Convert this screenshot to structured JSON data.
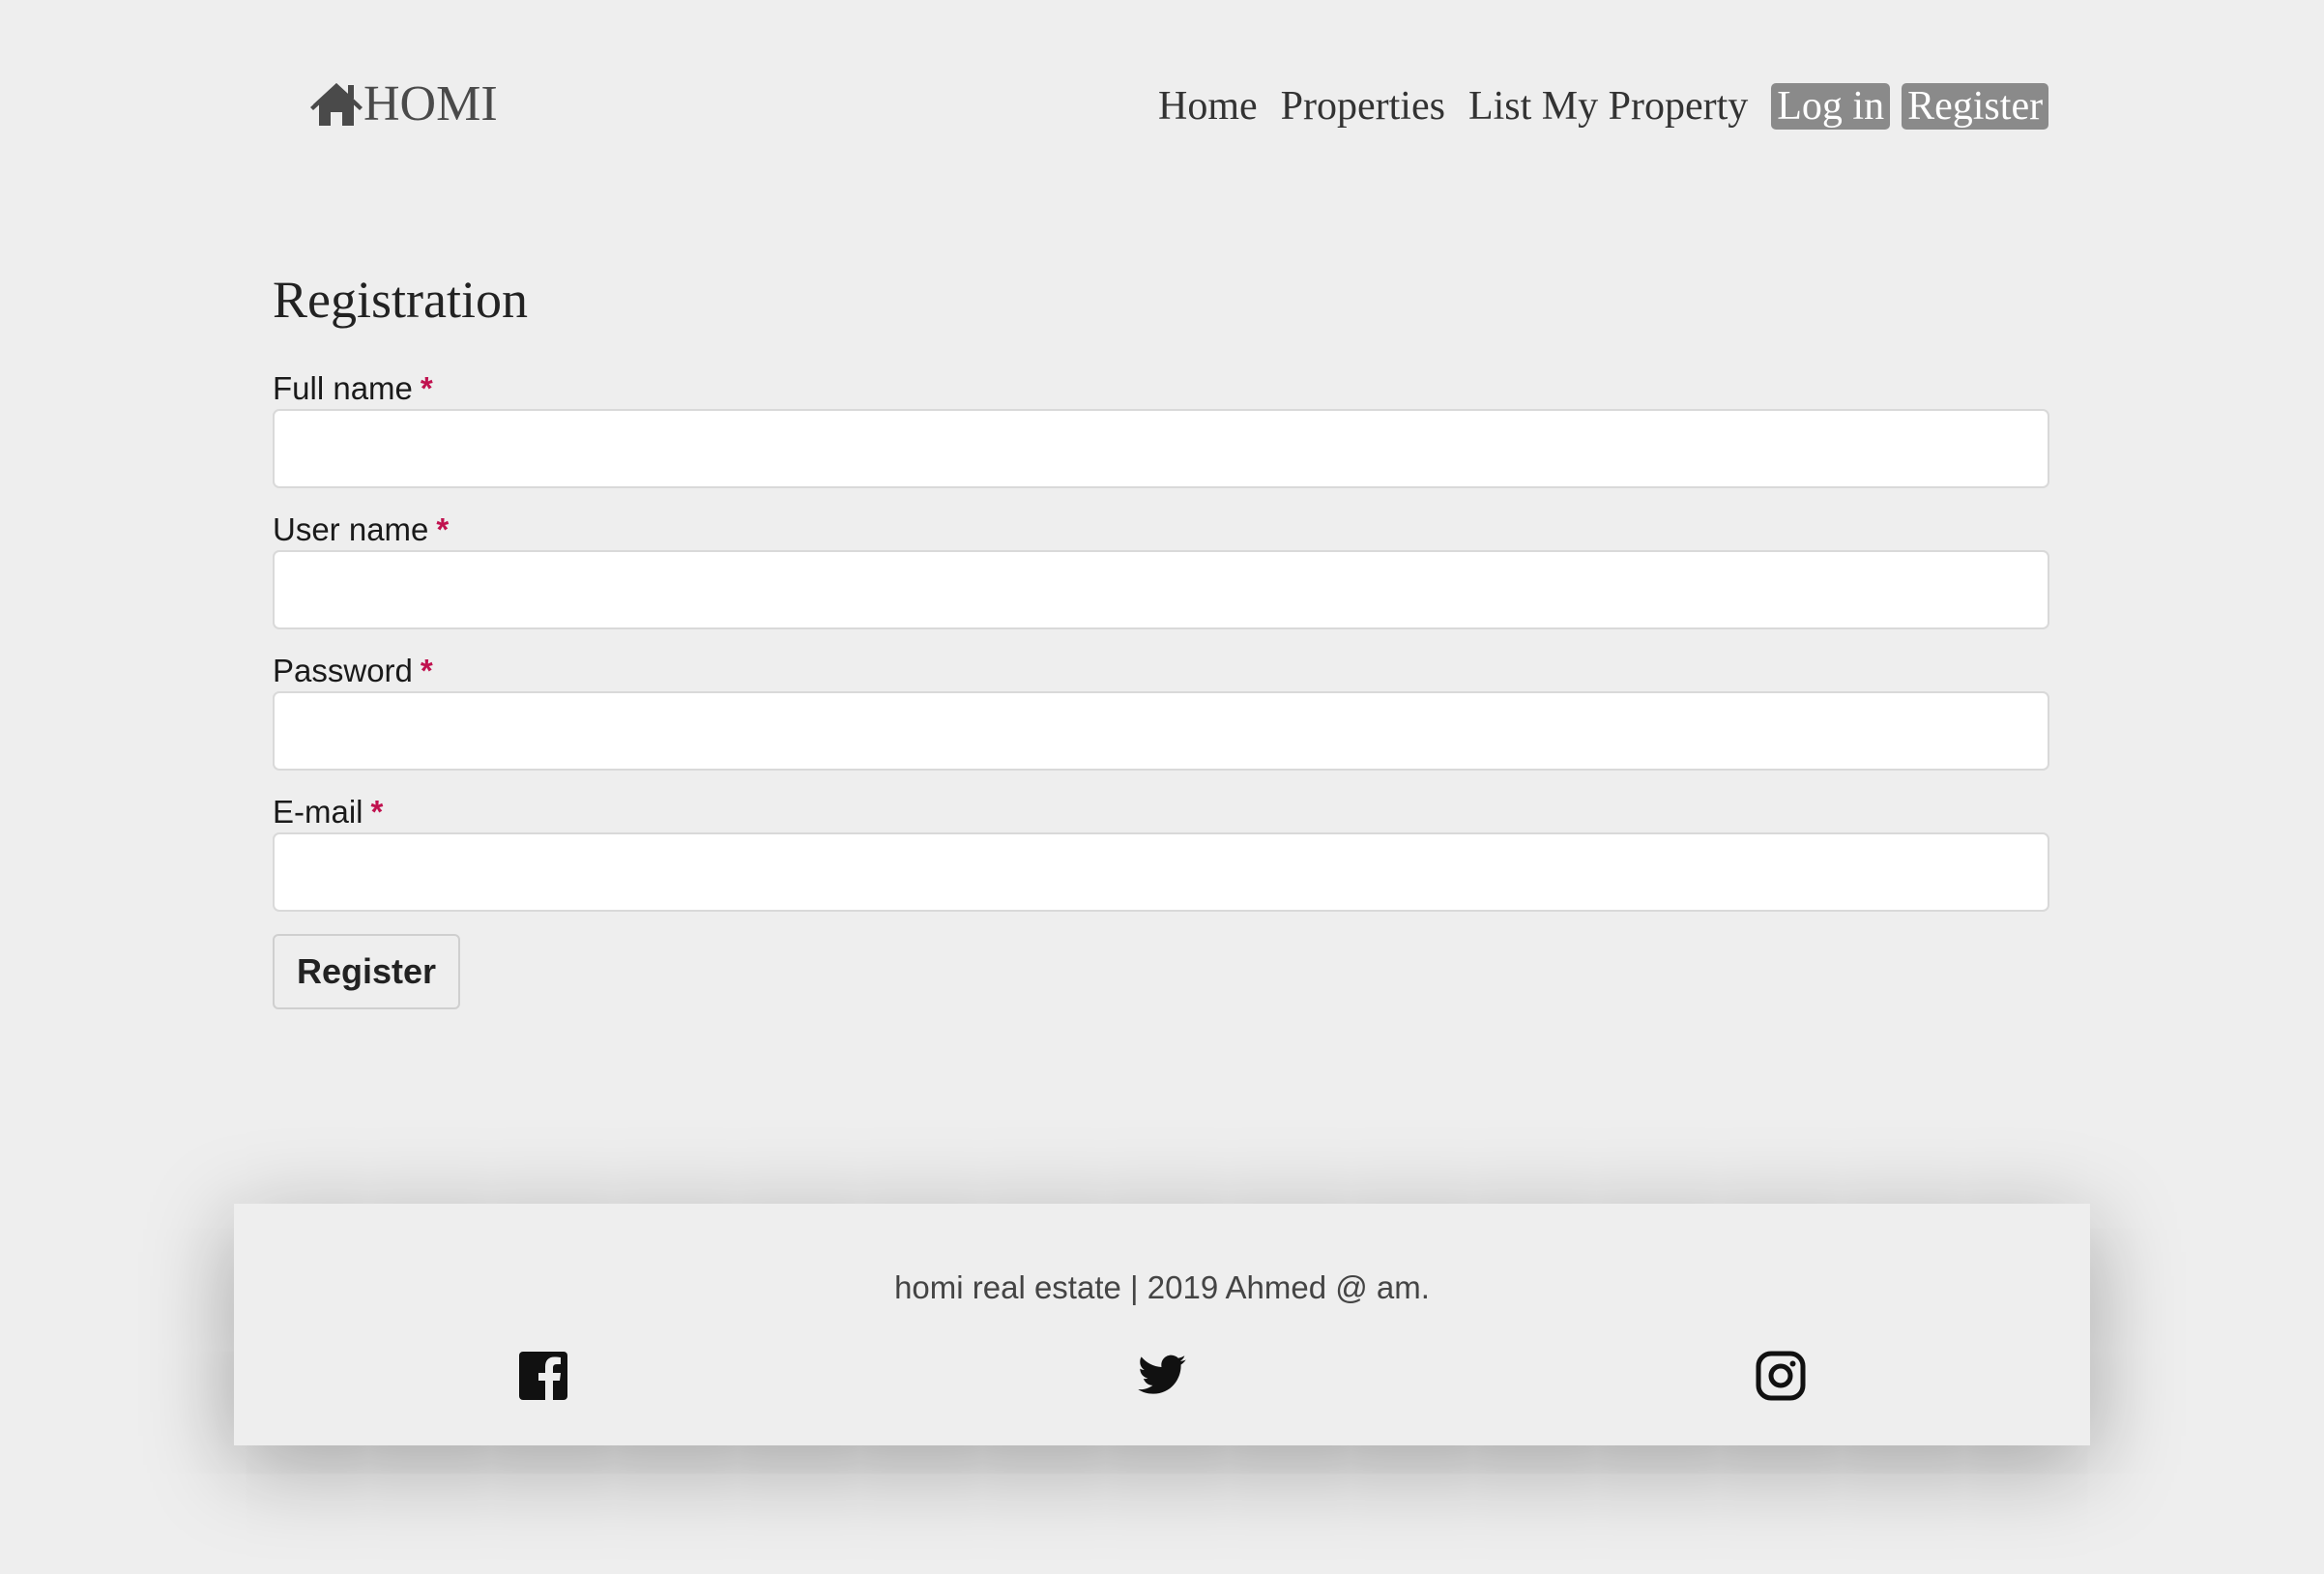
{
  "brand": {
    "name": "HOMI",
    "icon": "home-icon"
  },
  "nav": {
    "items": [
      {
        "label": "Home"
      },
      {
        "label": "Properties"
      },
      {
        "label": "List My Property"
      }
    ],
    "login_label": "Log in",
    "register_label": "Register"
  },
  "form": {
    "title": "Registration",
    "required_marker": "*",
    "fields": [
      {
        "label": "Full name",
        "value": "",
        "placeholder": ""
      },
      {
        "label": "User name",
        "value": "",
        "placeholder": ""
      },
      {
        "label": "Password",
        "value": "",
        "placeholder": ""
      },
      {
        "label": "E-mail",
        "value": "",
        "placeholder": ""
      }
    ],
    "submit_label": "Register"
  },
  "footer": {
    "text": "homi real estate | 2019 Ahmed @ am.",
    "social": [
      {
        "icon": "facebook-icon"
      },
      {
        "icon": "twitter-icon"
      },
      {
        "icon": "instagram-icon"
      }
    ]
  },
  "colors": {
    "background": "#eeeeee",
    "pill": "#8a8a8a",
    "required": "#c0124f"
  }
}
